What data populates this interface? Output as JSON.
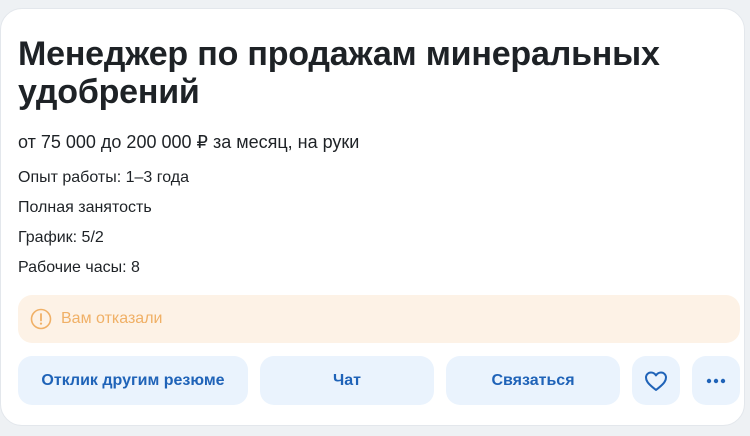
{
  "vacancy": {
    "title": "Менеджер по продажам минеральных удобрений",
    "salary": "от 75 000 до 200 000 ₽ за месяц, на руки",
    "experience": "Опыт работы: 1–3 года",
    "employment": "Полная занятость",
    "schedule": "График: 5/2",
    "hours": "Рабочие часы: 8"
  },
  "notice": {
    "icon": "info-circle-icon",
    "text": "Вам отказали"
  },
  "actions": {
    "respond_label": "Отклик другим резюме",
    "chat_label": "Чат",
    "contact_label": "Связаться",
    "favorite_icon": "heart-icon",
    "more_icon": "more-dots-icon"
  },
  "colors": {
    "accent": "#1f63b8",
    "button_bg": "#eaf3fd",
    "notice_bg": "#fdf2e6",
    "notice_text": "#f0b066"
  }
}
